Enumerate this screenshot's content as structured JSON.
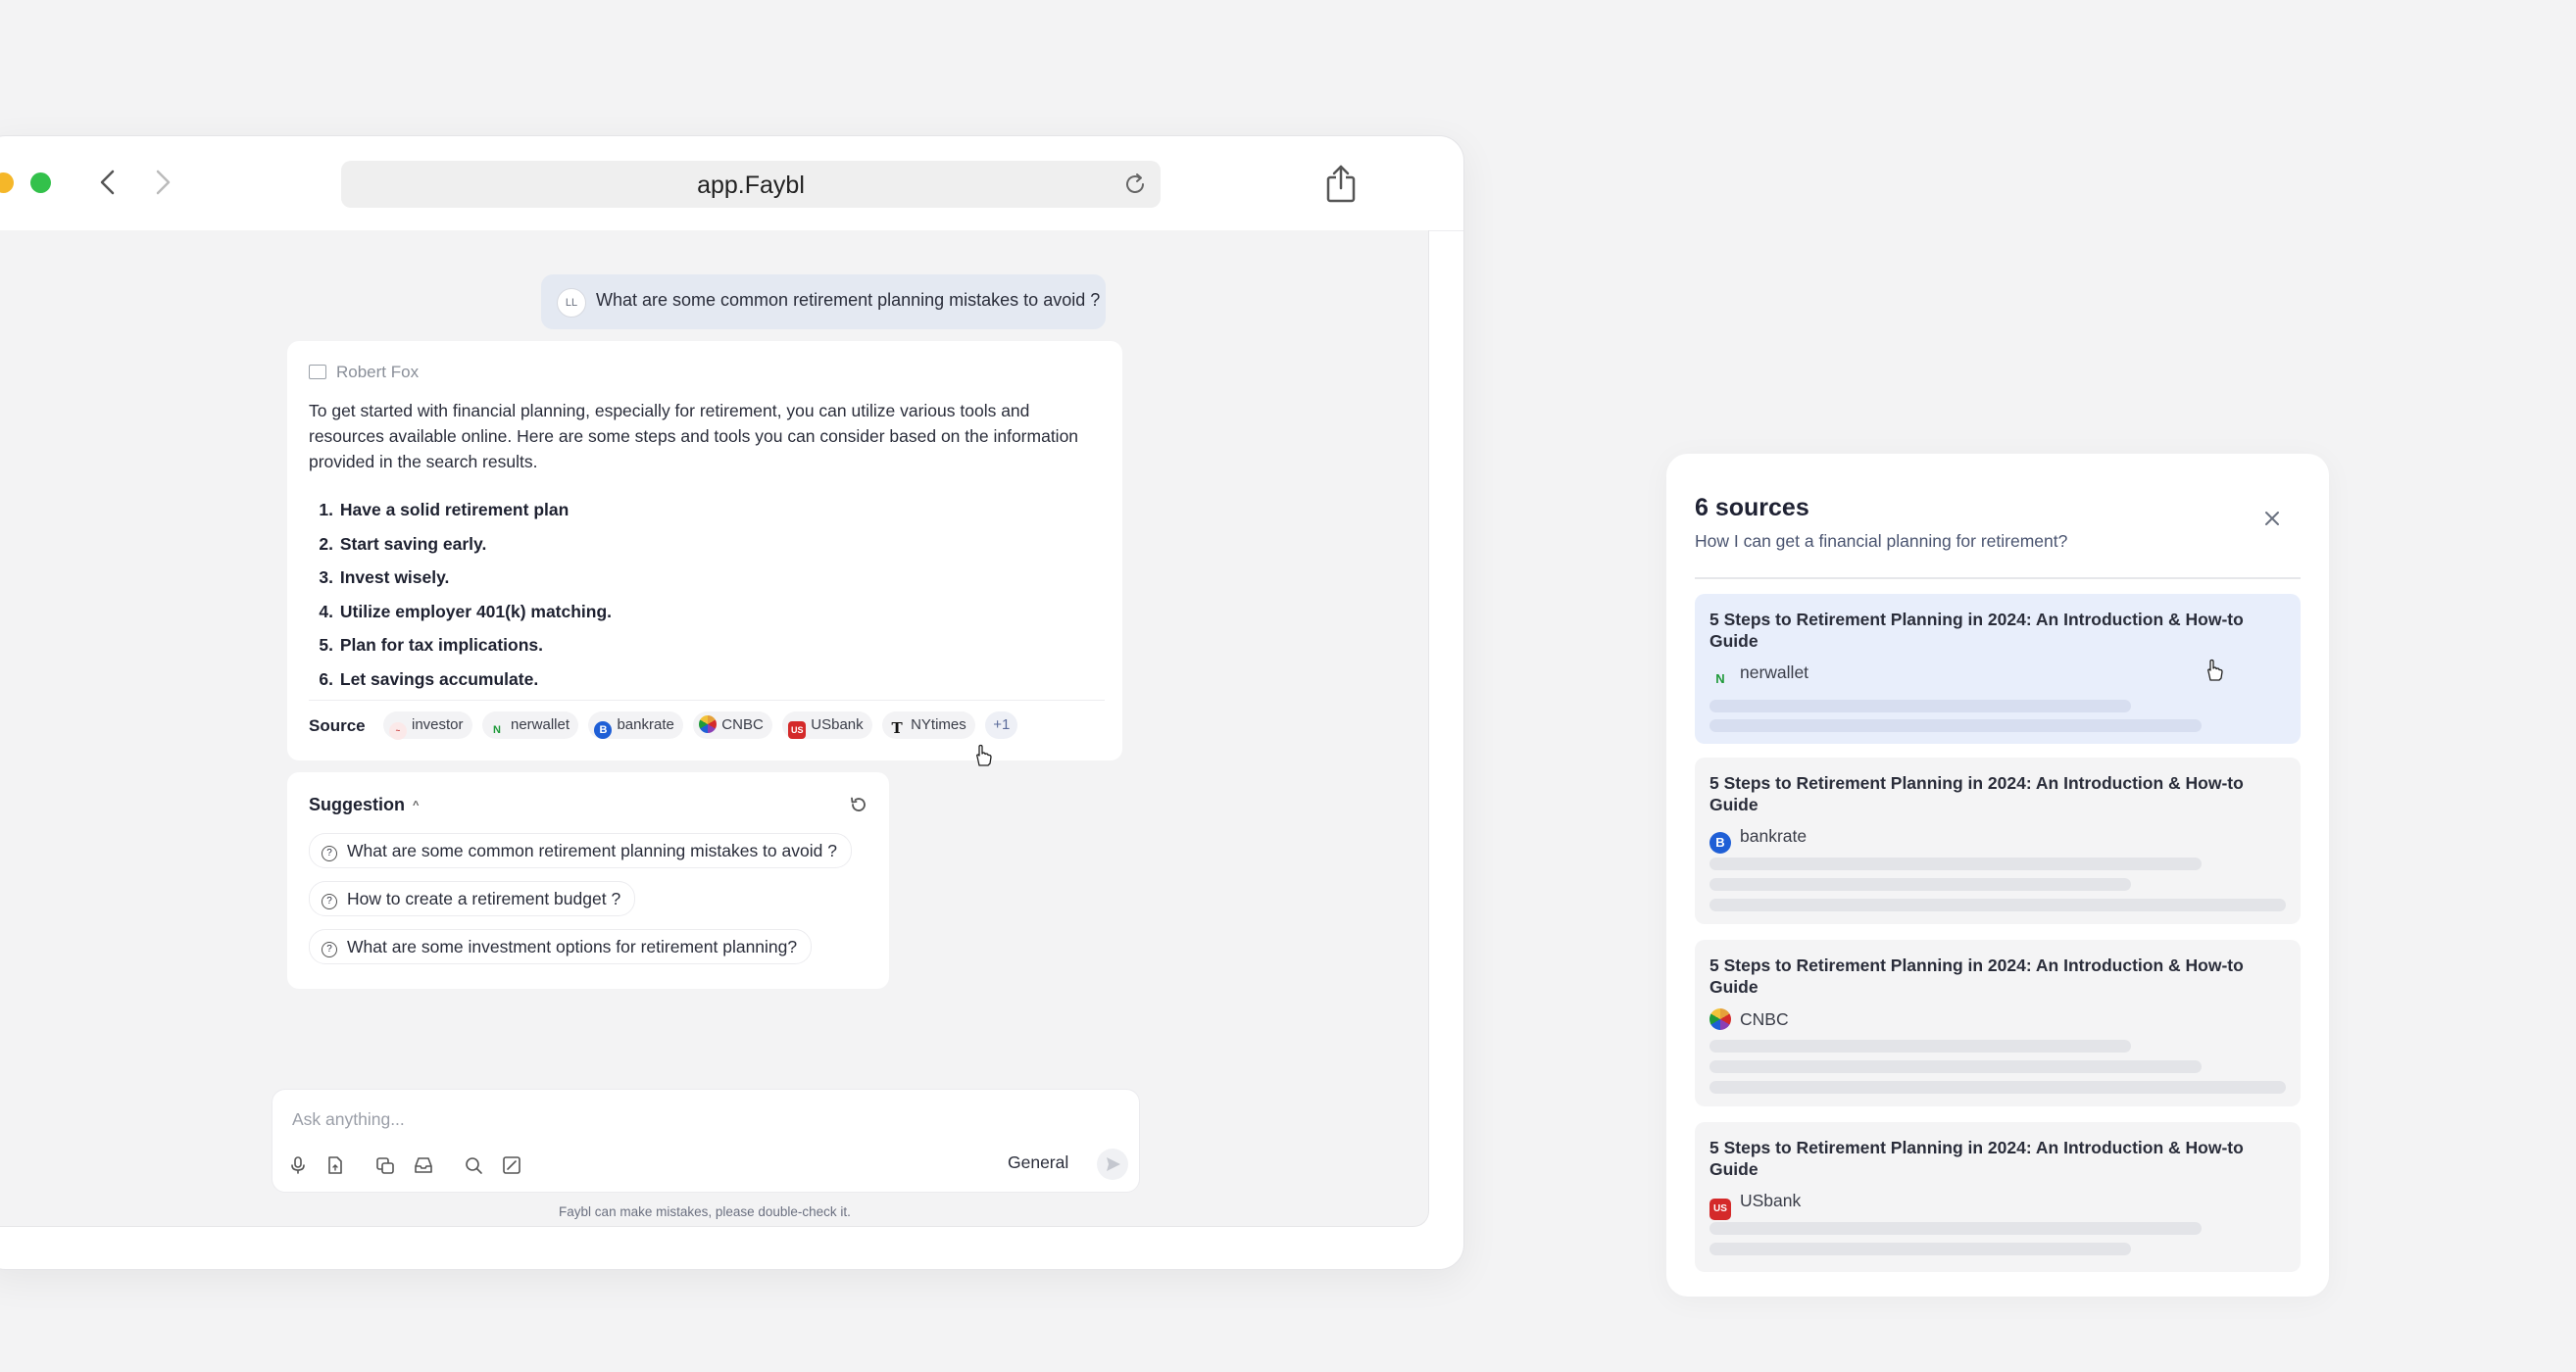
{
  "browser": {
    "url": "app.Faybl"
  },
  "chat": {
    "user_message": {
      "avatar": "LL",
      "text": "What are some common retirement planning mistakes to avoid ?"
    },
    "answer": {
      "author": "Robert Fox",
      "intro": "To get started with financial planning, especially for retirement, you can utilize various tools and resources available online. Here are some steps and tools you can consider based on the information provided in the search results.",
      "steps": [
        {
          "n": "1.",
          "text": "Have a solid retirement plan"
        },
        {
          "n": "2.",
          "text": "Start saving early."
        },
        {
          "n": "3.",
          "text": "Invest wisely."
        },
        {
          "n": "4.",
          "text": "Utilize employer 401(k) matching."
        },
        {
          "n": "5.",
          "text": "Plan for tax implications."
        },
        {
          "n": "6.",
          "text": "Let savings accumulate."
        }
      ],
      "source_label": "Source",
      "sources": [
        {
          "name": "investor",
          "icon": "investor-logo-icon",
          "color": "#f4d6d6"
        },
        {
          "name": "nerwallet",
          "icon": "nerdwallet-logo-icon",
          "color": "#1f9a3a"
        },
        {
          "name": "bankrate",
          "icon": "bankrate-logo-icon",
          "color": "#1f5fd6"
        },
        {
          "name": "CNBC",
          "icon": "cnbc-peacock-icon",
          "color": "#e5a13a"
        },
        {
          "name": "USbank",
          "icon": "usbank-logo-icon",
          "color": "#d42a2a"
        },
        {
          "name": "NYtimes",
          "icon": "nytimes-logo-icon",
          "color": "#111111"
        }
      ],
      "more_sources": "+1"
    },
    "suggestions": {
      "title": "Suggestion",
      "items": [
        "What are some common retirement planning mistakes to avoid ?",
        "How to create a retirement budget ?",
        "What are some investment options for retirement planning?"
      ]
    },
    "composer": {
      "placeholder": "Ask anything...",
      "mode": "General",
      "tools": [
        "microphone-icon",
        "attach-file-icon",
        "image-icon",
        "inbox-icon",
        "search-icon",
        "edit-icon"
      ]
    },
    "disclaimer": "Faybl can make mistakes, please double-check it."
  },
  "sources_panel": {
    "title": "6 sources",
    "subtitle": "How I can get a financial planning for retirement?",
    "cards": [
      {
        "title": "5 Steps to Retirement Planning in 2024: An Introduction & How-to Guide",
        "site": "nerwallet",
        "logo_text": "N",
        "color": "#1f9a3a",
        "active": true
      },
      {
        "title": "5 Steps to Retirement Planning in 2024: An Introduction & How-to Guide",
        "site": "bankrate",
        "logo_text": "B",
        "color": "#1f5fd6",
        "active": false
      },
      {
        "title": "5 Steps to Retirement Planning in 2024: An Introduction & How-to Guide",
        "site": "CNBC",
        "logo_text": "",
        "color": "#e5a13a",
        "active": false
      },
      {
        "title": "5 Steps to Retirement Planning in 2024: An Introduction & How-to Guide",
        "site": "USbank",
        "logo_text": "US",
        "color": "#d42a2a",
        "active": false
      }
    ]
  }
}
